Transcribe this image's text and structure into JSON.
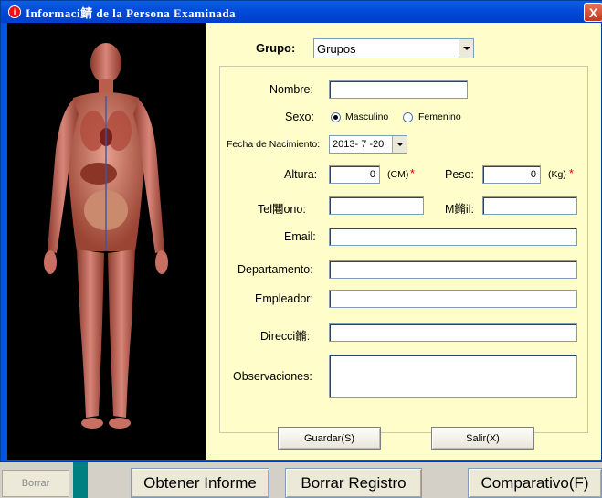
{
  "window": {
    "title": "Informaci鲭 de la Persona Examinada",
    "close_label": "X"
  },
  "background": {
    "borrar_small": "Borrar",
    "buttons": [
      "Obtener Informe",
      "Borrar Registro",
      "Comparativo(F)"
    ]
  },
  "form": {
    "grupo_label": "Grupo:",
    "grupo_value": "Grupos",
    "nombre_label": "Nombre:",
    "nombre_value": "",
    "sexo_label": "Sexo:",
    "sexo_masculino": "Masculino",
    "sexo_femenino": "Femenino",
    "sexo_selected": "Masculino",
    "fecha_label": "Fecha de Nacimiento:",
    "fecha_value": "2013- 7 -20",
    "altura_label": "Altura:",
    "altura_value": "0",
    "altura_unit": "(CM)",
    "peso_label": "Peso:",
    "peso_value": "0",
    "peso_unit": "(Kg)",
    "required_mark": "*",
    "telefono_label": "Tel闀ono:",
    "telefono_value": "",
    "movil_label": "M鏅il:",
    "movil_value": "",
    "email_label": "Email:",
    "email_value": "",
    "departamento_label": "Departamento:",
    "departamento_value": "",
    "empleador_label": "Empleador:",
    "empleador_value": "",
    "direccion_label": "Direcci鏅:",
    "direccion_value": "",
    "observaciones_label": "Observaciones:",
    "observaciones_value": "",
    "guardar_label": "Guardar(S)",
    "salir_label": "Salir(X)"
  },
  "colors": {
    "titlebar": "#0054e3",
    "form_bg": "#fffdc9",
    "figure_bg": "#000000",
    "required": "#d40000"
  }
}
